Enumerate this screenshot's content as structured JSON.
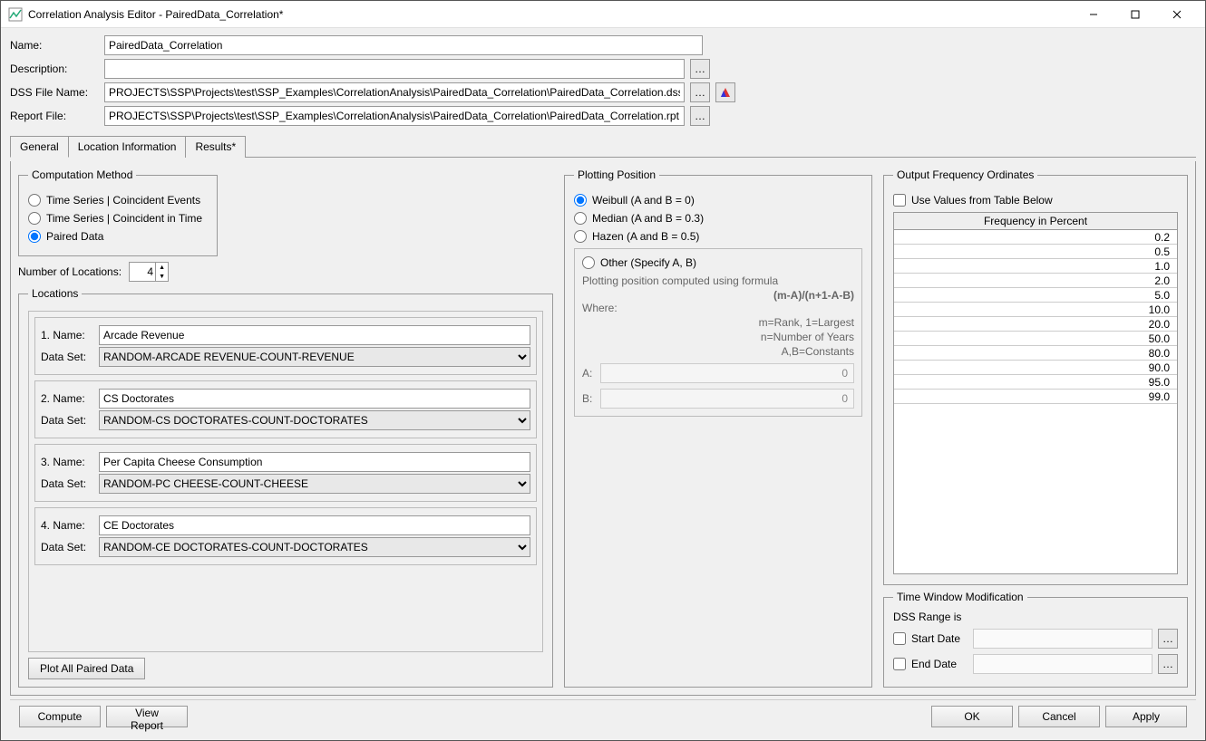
{
  "window": {
    "title": "Correlation Analysis Editor - PairedData_Correlation*"
  },
  "form": {
    "name_label": "Name:",
    "name_value": "PairedData_Correlation",
    "desc_label": "Description:",
    "desc_value": "",
    "dss_label": "DSS File Name:",
    "dss_value": "PROJECTS\\SSP\\Projects\\test\\SSP_Examples\\CorrelationAnalysis\\PairedData_Correlation\\PairedData_Correlation.dss",
    "rpt_label": "Report File:",
    "rpt_value": "PROJECTS\\SSP\\Projects\\test\\SSP_Examples\\CorrelationAnalysis\\PairedData_Correlation\\PairedData_Correlation.rpt"
  },
  "tabs": {
    "general": "General",
    "location": "Location Information",
    "results": "Results*"
  },
  "comp": {
    "legend": "Computation Method",
    "opt1": "Time Series | Coincident Events",
    "opt2": "Time Series | Coincident in Time",
    "opt3": "Paired Data"
  },
  "numloc": {
    "label": "Number of Locations:",
    "value": "4"
  },
  "locations": {
    "legend": "Locations",
    "name_label": "Name:",
    "dataset_label": "Data Set:",
    "items": [
      {
        "idx": "1.",
        "name": "Arcade Revenue",
        "dataset": "RANDOM-ARCADE REVENUE-COUNT-REVENUE"
      },
      {
        "idx": "2.",
        "name": "CS Doctorates",
        "dataset": "RANDOM-CS DOCTORATES-COUNT-DOCTORATES"
      },
      {
        "idx": "3.",
        "name": "Per Capita Cheese Consumption",
        "dataset": "RANDOM-PC CHEESE-COUNT-CHEESE"
      },
      {
        "idx": "4.",
        "name": "CE Doctorates",
        "dataset": "RANDOM-CE DOCTORATES-COUNT-DOCTORATES"
      }
    ],
    "plot_btn": "Plot All Paired Data"
  },
  "plot": {
    "legend": "Plotting Position",
    "weibull": "Weibull (A and B = 0)",
    "median": "Median (A and B = 0.3)",
    "hazen": "Hazen (A and B = 0.5)",
    "other": "Other (Specify A, B)",
    "desc": "Plotting position computed using formula",
    "formula": "(m-A)/(n+1-A-B)",
    "where": "Where:",
    "l1": "m=Rank, 1=Largest",
    "l2": "n=Number of Years",
    "l3": "A,B=Constants",
    "a": "A:",
    "a_val": "0",
    "b": "B:",
    "b_val": "0"
  },
  "freq": {
    "legend": "Output Frequency Ordinates",
    "checkbox": "Use Values from Table Below",
    "header": "Frequency in Percent",
    "values": [
      "0.2",
      "0.5",
      "1.0",
      "2.0",
      "5.0",
      "10.0",
      "20.0",
      "50.0",
      "80.0",
      "90.0",
      "95.0",
      "99.0"
    ]
  },
  "tw": {
    "legend": "Time Window Modification",
    "range": "DSS Range is",
    "start": "Start Date",
    "end": "End Date"
  },
  "footer": {
    "compute": "Compute",
    "view": "View Report",
    "ok": "OK",
    "cancel": "Cancel",
    "apply": "Apply"
  }
}
